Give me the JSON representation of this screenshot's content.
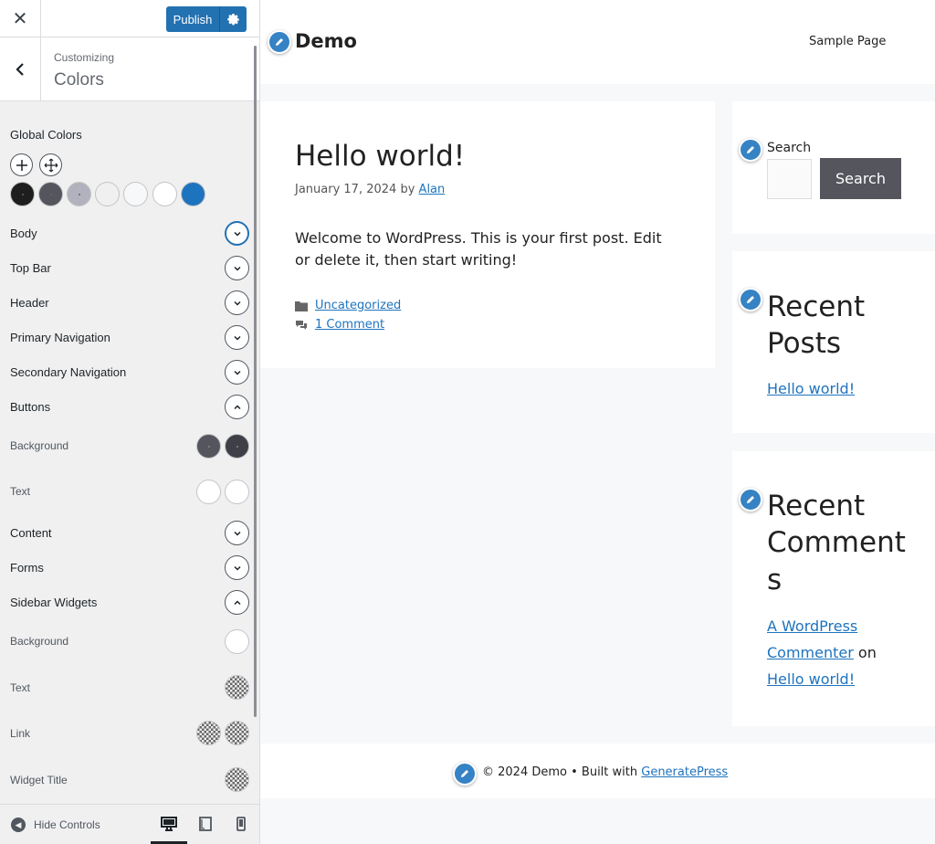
{
  "sidebar": {
    "close_glyph": "✕",
    "publish_label": "Publish",
    "breadcrumb": "Customizing",
    "section_title": "Colors",
    "global_colors_label": "Global Colors",
    "global_swatches": [
      "#1e1e1e",
      "#55555e",
      "#b2b2be",
      "#f0f0f0",
      "#f7f8f9",
      "#ffffff",
      "#1e73be"
    ],
    "rows": [
      {
        "label": "Body",
        "state": "collapsed-focused"
      },
      {
        "label": "Top Bar",
        "state": "collapsed"
      },
      {
        "label": "Header",
        "state": "collapsed"
      },
      {
        "label": "Primary Navigation",
        "state": "collapsed"
      },
      {
        "label": "Secondary Navigation",
        "state": "collapsed"
      },
      {
        "label": "Buttons",
        "state": "expanded"
      },
      {
        "label": "Background",
        "sub": true
      },
      {
        "label": "Text",
        "sub": true
      },
      {
        "label": "Content",
        "state": "collapsed"
      },
      {
        "label": "Forms",
        "state": "collapsed"
      },
      {
        "label": "Sidebar Widgets",
        "state": "expanded"
      },
      {
        "label": "Background",
        "sub": true
      },
      {
        "label": "Text",
        "sub": true
      },
      {
        "label": "Link",
        "sub": true
      },
      {
        "label": "Widget Title",
        "sub": true
      }
    ],
    "buttons_background_colors": [
      "#55555e",
      "#3f4047"
    ],
    "buttons_text_colors": [
      "#ffffff",
      "#ffffff"
    ],
    "sidebar_background_color": "#ffffff",
    "hide_controls_label": "Hide Controls",
    "device_modes": [
      "desktop-icon",
      "tablet-icon",
      "mobile-icon"
    ],
    "active_device": "desktop-icon"
  },
  "preview": {
    "site_title": "Demo",
    "nav_item": "Sample Page",
    "post": {
      "title": "Hello world!",
      "date": "January 17, 2024",
      "by": "by",
      "author": "Alan",
      "content": "Welcome to WordPress. This is your first post. Edit or delete it, then start writing!",
      "category": "Uncategorized",
      "comments": "1 Comment"
    },
    "search_widget": {
      "label": "Search",
      "button": "Search"
    },
    "recent_posts": {
      "title_line1": "Recent",
      "title_line2": "Posts",
      "item": "Hello world!"
    },
    "recent_comments": {
      "title_line1": "Recent",
      "title_line2": "Comment",
      "title_line3": "s",
      "author_line1": "A WordPress",
      "author_line2": "Commenter",
      "on": "on",
      "post": "Hello world!"
    },
    "footer": {
      "copyright": "© 2024 Demo • Built with",
      "link": "GeneratePress"
    },
    "accent": "#3582c4",
    "link_color": "#1e73be"
  }
}
